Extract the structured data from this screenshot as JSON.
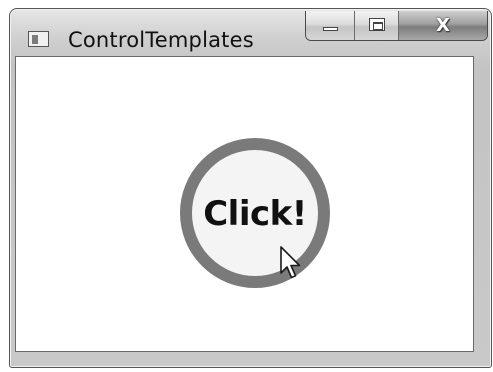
{
  "window": {
    "title": "ControlTemplates",
    "controls": {
      "minimize_icon": "minimize-icon",
      "maximize_icon": "maximize-icon",
      "close_glyph": "X"
    }
  },
  "content": {
    "button_label": "Click!"
  },
  "colors": {
    "ring": "#7a7a7a",
    "client_background": "#ffffff",
    "frame": "#c9c9c9"
  }
}
